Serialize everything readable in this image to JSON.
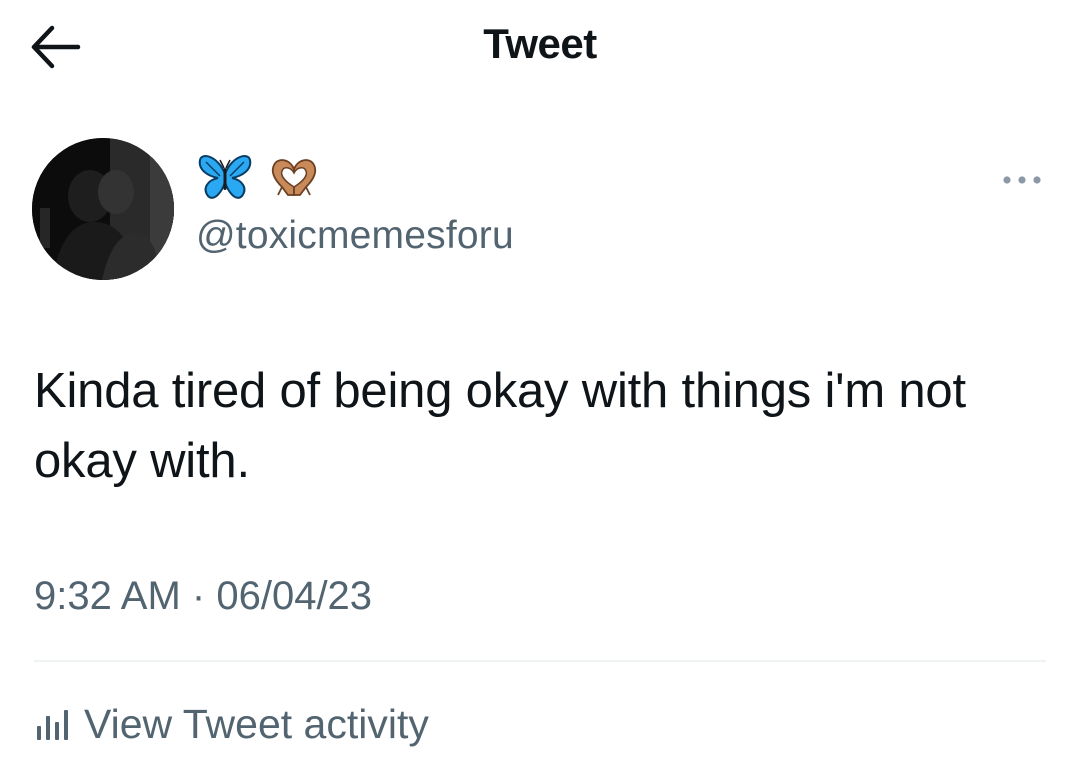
{
  "header": {
    "title": "Tweet",
    "back_icon": "arrow-left-icon"
  },
  "author": {
    "display_name_icons": [
      "butterfly-emoji-icon",
      "heart-hands-emoji-icon"
    ],
    "handle": "@toxicmemesforu",
    "avatar_icon": "avatar-photo"
  },
  "tweet": {
    "text": "Kinda tired of being okay with things i'm not okay with.",
    "time": "9:32 AM",
    "separator": "·",
    "date": "06/04/23"
  },
  "actions": {
    "more_icon": "more-options-icon",
    "activity_icon": "bar-chart-icon",
    "activity_label": "View Tweet activity"
  },
  "colors": {
    "text_primary": "#0f1419",
    "text_secondary": "#536471",
    "divider": "#eff3f4",
    "butterfly": "#2aa8f2"
  }
}
